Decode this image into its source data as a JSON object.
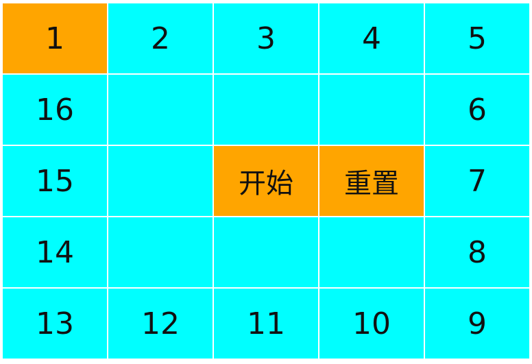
{
  "colors": {
    "tile": "#00ffff",
    "active_tile": "#ffa500",
    "button": "#ffa500"
  },
  "board": {
    "cells": {
      "c1": "1",
      "c2": "2",
      "c3": "3",
      "c4": "4",
      "c5": "5",
      "c6": "6",
      "c7": "7",
      "c8": "8",
      "c9": "9",
      "c10": "10",
      "c11": "11",
      "c12": "12",
      "c13": "13",
      "c14": "14",
      "c15": "15",
      "c16": "16"
    },
    "active_cell": "1"
  },
  "controls": {
    "start_label": "开始",
    "reset_label": "重置"
  }
}
